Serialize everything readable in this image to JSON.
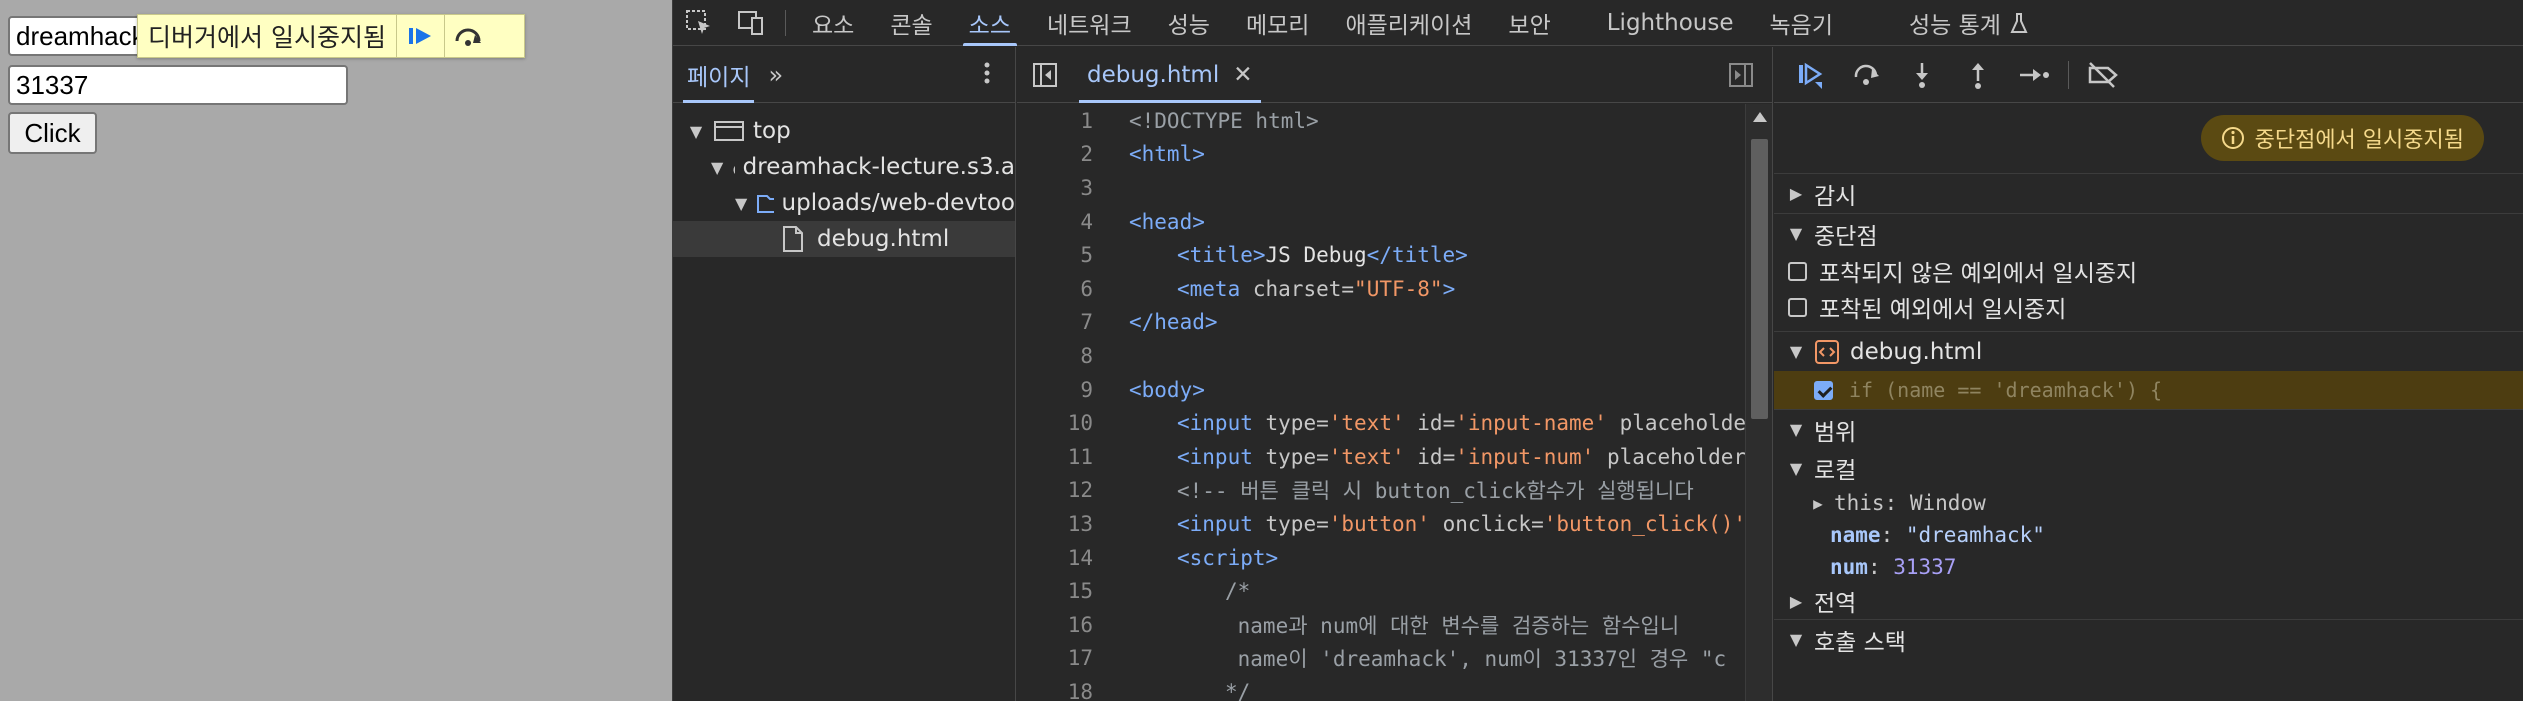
{
  "page": {
    "name_value": "dreamhack",
    "num_value": "31337",
    "click_label": "Click",
    "paused_banner_text": "디버거에서 일시중지됨"
  },
  "devtools": {
    "tabs": [
      "요소",
      "콘솔",
      "소스",
      "네트워크",
      "성능",
      "메모리",
      "애플리케이션",
      "보안",
      "Lighthouse",
      "녹음기",
      "성능 통계"
    ],
    "active_tab": "소스",
    "navigator": {
      "tab_label": "페이지",
      "tree": [
        {
          "label": "top",
          "level": 0
        },
        {
          "label": "dreamhack-lecture.s3.a",
          "level": 1
        },
        {
          "label": "uploads/web-devtoo",
          "level": 2
        },
        {
          "label": "debug.html",
          "level": 3
        }
      ]
    },
    "editor": {
      "file_tab": "debug.html",
      "close_glyph": "✕",
      "lines": [
        {
          "n": "1",
          "html": "<span class=\"t-com\">&lt;!DOCTYPE html&gt;</span>",
          "indent": 0
        },
        {
          "n": "2",
          "html": "<span class=\"t-tag\">&lt;html&gt;</span>",
          "indent": 0
        },
        {
          "n": "3",
          "html": "",
          "indent": 0
        },
        {
          "n": "4",
          "html": "<span class=\"t-tag\">&lt;head&gt;</span>",
          "indent": 0
        },
        {
          "n": "5",
          "html": "<span class=\"t-tag\">&lt;title&gt;</span><span class=\"t-txt\">JS Debug</span><span class=\"t-tag\">&lt;/title&gt;</span>",
          "indent": 1
        },
        {
          "n": "6",
          "html": "<span class=\"t-tag\">&lt;meta</span> <span class=\"t-attr\">charset</span>=<span class=\"t-val\">\"UTF-8\"</span><span class=\"t-tag\">&gt;</span>",
          "indent": 1
        },
        {
          "n": "7",
          "html": "<span class=\"t-tag\">&lt;/head&gt;</span>",
          "indent": 0
        },
        {
          "n": "8",
          "html": "",
          "indent": 0
        },
        {
          "n": "9",
          "html": "<span class=\"t-tag\">&lt;body&gt;</span>",
          "indent": 0
        },
        {
          "n": "10",
          "html": "<span class=\"t-tag\">&lt;input</span> <span class=\"t-attr\">type</span>=<span class=\"t-val\">'text'</span> <span class=\"t-attr\">id</span>=<span class=\"t-val\">'input-name'</span> <span class=\"t-attr\">placeholder</span>",
          "indent": 1
        },
        {
          "n": "11",
          "html": "<span class=\"t-tag\">&lt;input</span> <span class=\"t-attr\">type</span>=<span class=\"t-val\">'text'</span> <span class=\"t-attr\">id</span>=<span class=\"t-val\">'input-num'</span> <span class=\"t-attr\">placeholder</span>=",
          "indent": 1
        },
        {
          "n": "12",
          "html": "<span class=\"t-com\">&lt;!-- 버튼 클릭 시 button_click함수가 실행됩니다</span>",
          "indent": 1
        },
        {
          "n": "13",
          "html": "<span class=\"t-tag\">&lt;input</span> <span class=\"t-attr\">type</span>=<span class=\"t-val\">'button'</span> <span class=\"t-attr\">onclick</span>=<span class=\"t-val\">'button_click()'</span>",
          "indent": 1
        },
        {
          "n": "14",
          "html": "<span class=\"t-tag\">&lt;script&gt;</span>",
          "indent": 1
        },
        {
          "n": "15",
          "html": "<span class=\"t-com\">/*</span>",
          "indent": 2
        },
        {
          "n": "16",
          "html": "<span class=\"t-com\"> name과 num에 대한 변수를 검증하는 함수입니</span>",
          "indent": 2
        },
        {
          "n": "17",
          "html": "<span class=\"t-com\"> name이 'dreamhack', num이 31337인 경우 \"c</span>",
          "indent": 2
        },
        {
          "n": "18",
          "html": "<span class=\"t-com\">*/</span>",
          "indent": 2
        }
      ]
    },
    "debugger": {
      "paused_message": "중단점에서 일시중지됨",
      "sections": {
        "watch": "감시",
        "breakpoints": "중단점",
        "scope": "범위",
        "local": "로컬",
        "global": "전역",
        "call_stack": "호출 스택"
      },
      "exceptions": {
        "uncaught": "포착되지 않은 예외에서 일시중지",
        "caught": "포착된 예외에서 일시중지"
      },
      "breakpoint_file": "debug.html",
      "breakpoint_code": "if (name == 'dreamhack') {",
      "scope_vars": {
        "this_key": "this",
        "this_val": "Window",
        "name_key": "name",
        "name_val": "\"dreamhack\"",
        "num_key": "num",
        "num_val": "31337"
      }
    }
  }
}
